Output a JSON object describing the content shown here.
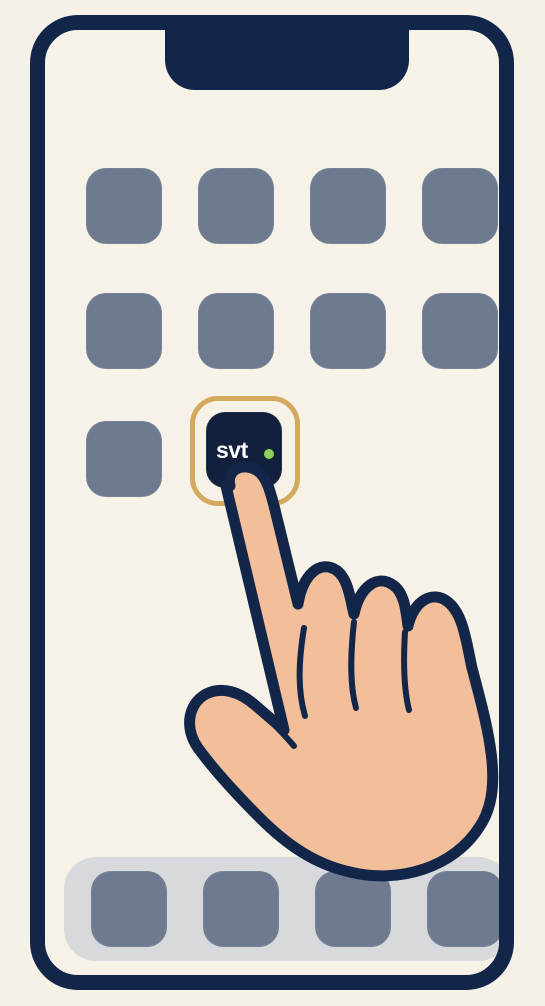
{
  "highlighted_app": {
    "label": "svt",
    "colors": {
      "background": "#13203b",
      "text": "#ffffff",
      "dot": "#8fd05a"
    }
  },
  "colors": {
    "page_background": "#f6f1e7",
    "phone_frame": "#12264a",
    "phone_screen": "#f7f2e8",
    "placeholder_app": "#6d7a8f",
    "dock": "#d8d9dc",
    "highlight_ring": "#d4a85d",
    "hand_fill": "#f2bf9a",
    "hand_outline": "#12264a"
  },
  "icons": {
    "hand": "tap-hand-icon",
    "highlight": "focus-ring-icon"
  }
}
